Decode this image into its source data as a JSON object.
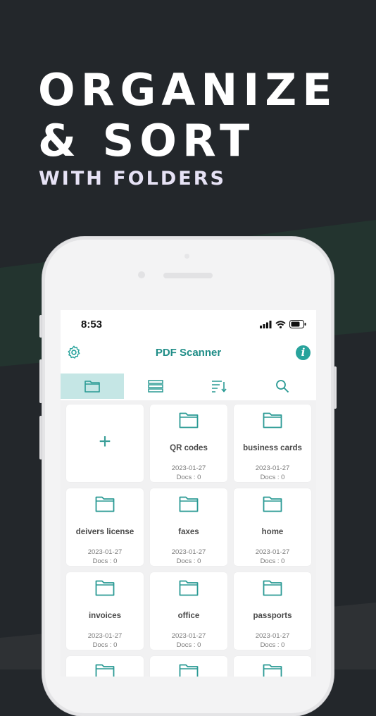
{
  "promo": {
    "headline_line1": "ORGANIZE",
    "headline_line2": "& SORT",
    "subheadline": "WITH FOLDERS"
  },
  "status_bar": {
    "time": "8:53"
  },
  "app": {
    "title": "PDF Scanner"
  },
  "toolbar": {
    "active": "folders",
    "tools": [
      "folder-view",
      "list-view",
      "sort",
      "search"
    ]
  },
  "add_folder_symbol": "+",
  "info_symbol": "i",
  "folders": [
    {
      "name": "QR codes",
      "date": "2023-01-27",
      "docs": "Docs : 0"
    },
    {
      "name": "business cards",
      "date": "2023-01-27",
      "docs": "Docs : 0"
    },
    {
      "name": "deivers license",
      "date": "2023-01-27",
      "docs": "Docs : 0"
    },
    {
      "name": "faxes",
      "date": "2023-01-27",
      "docs": "Docs : 0"
    },
    {
      "name": "home",
      "date": "2023-01-27",
      "docs": "Docs : 0"
    },
    {
      "name": "invoices",
      "date": "2023-01-27",
      "docs": "Docs : 0"
    },
    {
      "name": "office",
      "date": "2023-01-27",
      "docs": "Docs : 0"
    },
    {
      "name": "passports",
      "date": "2023-01-27",
      "docs": "Docs : 0"
    }
  ],
  "colors": {
    "accent": "#28a39c",
    "background": "#23272b",
    "active_tab": "#c5e6e5"
  }
}
